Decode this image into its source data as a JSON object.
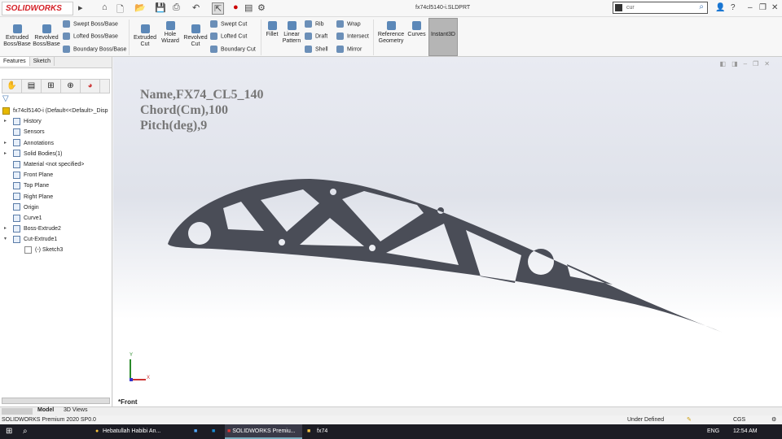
{
  "app": {
    "logo": "SOLIDWORKS",
    "document_title": "fx74cl5140-i.SLDPRT",
    "search_value": "cur"
  },
  "ribbon": {
    "extruded_boss": "Extruded Boss/Base",
    "revolved_boss": "Revolved Boss/Base",
    "swept_boss": "Swept Boss/Base",
    "lofted_boss": "Lofted Boss/Base",
    "boundary_boss": "Boundary Boss/Base",
    "extruded_cut": "Extruded Cut",
    "hole_wizard": "Hole Wizard",
    "revolved_cut": "Revolved Cut",
    "swept_cut": "Swept Cut",
    "lofted_cut": "Lofted Cut",
    "boundary_cut": "Boundary Cut",
    "fillet": "Fillet",
    "linear_pattern": "Linear Pattern",
    "rib": "Rib",
    "draft": "Draft",
    "shell": "Shell",
    "wrap": "Wrap",
    "intersect": "Intersect",
    "mirror": "Mirror",
    "reference_geometry": "Reference Geometry",
    "curves": "Curves",
    "instant3d": "Instant3D"
  },
  "panel": {
    "tabs": [
      "Features",
      "Sketch"
    ],
    "root": "fx74cl5140-i  (Default<<Default>_Disp",
    "items": [
      {
        "label": "History",
        "arrow": true
      },
      {
        "label": "Sensors",
        "arrow": false
      },
      {
        "label": "Annotations",
        "arrow": true
      },
      {
        "label": "Solid Bodies(1)",
        "arrow": true
      },
      {
        "label": "Material <not specified>",
        "arrow": false
      },
      {
        "label": "Front Plane",
        "arrow": false
      },
      {
        "label": "Top Plane",
        "arrow": false
      },
      {
        "label": "Right Plane",
        "arrow": false
      },
      {
        "label": "Origin",
        "arrow": false
      },
      {
        "label": "Curve1",
        "arrow": false
      },
      {
        "label": "Boss-Extrude2",
        "arrow": true
      },
      {
        "label": "Cut-Extrude1",
        "arrow": true,
        "expanded": true
      }
    ],
    "child": "(-) Sketch3"
  },
  "viewport": {
    "note": [
      "Name,FX74_CL5_140",
      "Chord(Cm),100",
      "Pitch(deg),9"
    ],
    "view_label": "*Front",
    "axis_x": "X",
    "axis_y": "Y",
    "part_color": "#4a4d57"
  },
  "bottom_tabs": [
    "Model",
    "3D Views"
  ],
  "status": {
    "product": "SOLIDWORKS Premium 2020 SP0.0",
    "state": "Under Defined",
    "units": "CGS"
  },
  "taskbar": {
    "chrome": "Hebatullah Habibi An...",
    "solidworks": "SOLIDWORKS Premiu...",
    "folder": "fx74",
    "lang": "ENG",
    "time": "12:54 AM"
  }
}
